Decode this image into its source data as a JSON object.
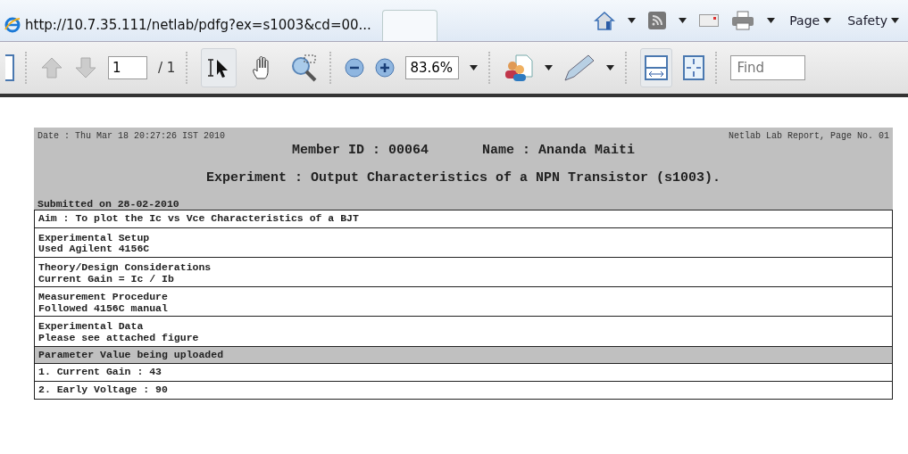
{
  "browser": {
    "tab_title": "http://10.7.35.111/netlab/pdfg?ex=s1003&cd=00...",
    "menus": [
      {
        "label": "Page"
      },
      {
        "label": "Safety"
      }
    ]
  },
  "pdf_toolbar": {
    "page_number": "1",
    "page_total": "/ 1",
    "zoom": "83.6%",
    "find_placeholder": "Find",
    "select_tool_selected": true,
    "fit_width_selected": true
  },
  "report": {
    "date": "Date : Thu Mar 18 20:27:26 IST 2010",
    "page_label": "Netlab Lab Report, Page No. 01",
    "member_id": "Member ID : 00064",
    "name": "Name : Ananda Maiti",
    "experiment": "Experiment : Output Characteristics of a NPN Transistor (s1003).",
    "submitted": "Submitted on 28-02-2010",
    "rows": [
      {
        "kind": "single",
        "text": "Aim : To plot the Ic vs Vce Characteristics of a BJT"
      },
      {
        "kind": "section",
        "heading": "Experimental Setup",
        "body": "Used Agilent 4156C"
      },
      {
        "kind": "section",
        "heading": "Theory/Design Considerations",
        "body": "Current Gain = Ic / Ib"
      },
      {
        "kind": "section",
        "heading": "Measurement Procedure",
        "body": "Followed 4156C manual"
      },
      {
        "kind": "section",
        "heading": "Experimental Data",
        "body": "Please see attached figure"
      },
      {
        "kind": "highlight",
        "text": "Parameter Value being uploaded"
      },
      {
        "kind": "single",
        "text": "1. Current Gain : 43"
      },
      {
        "kind": "single",
        "text": "2. Early Voltage : 90"
      }
    ]
  }
}
